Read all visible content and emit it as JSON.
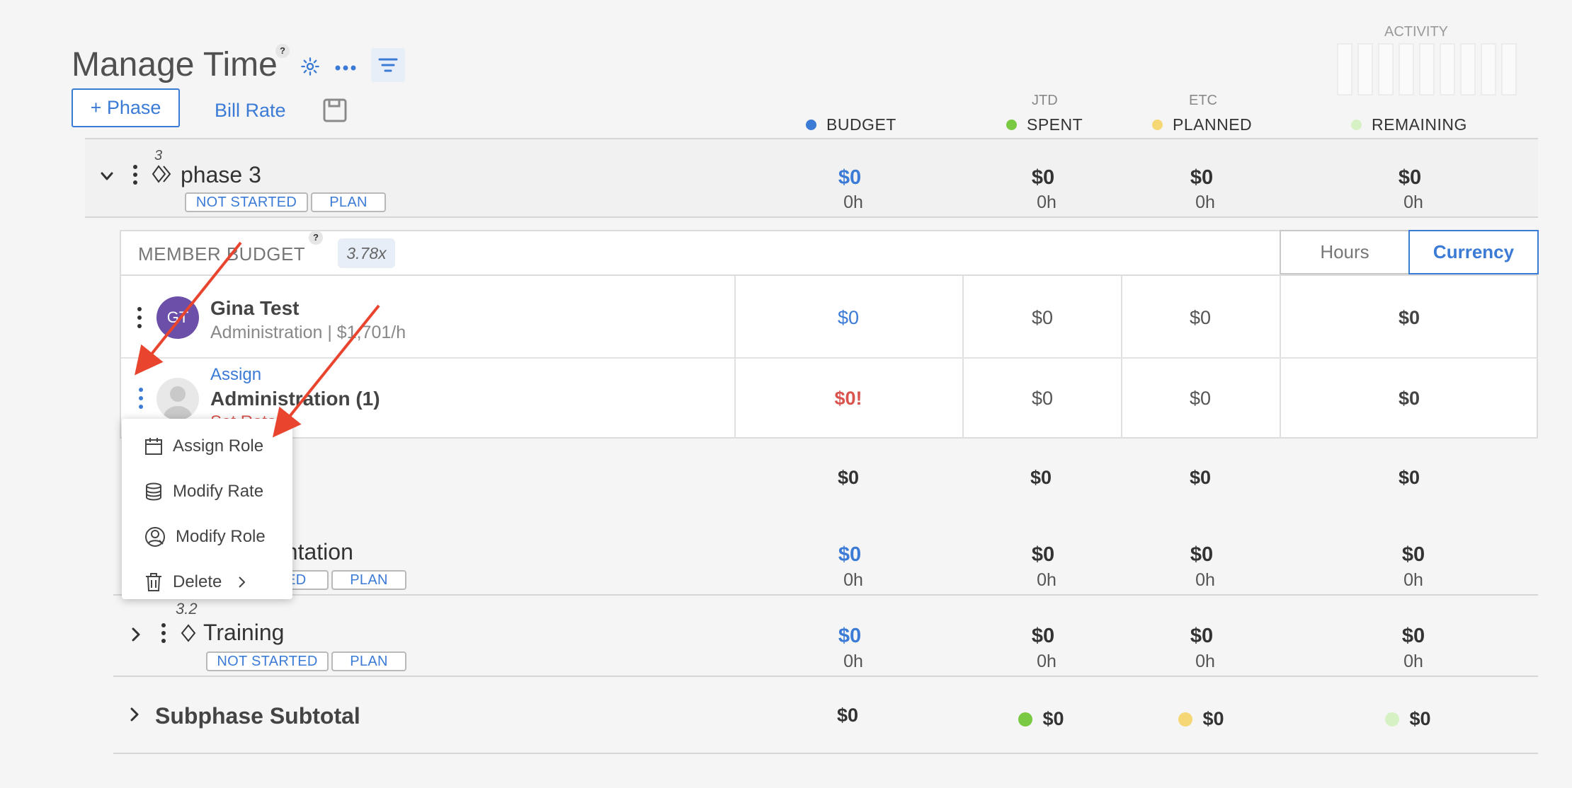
{
  "header": {
    "title": "Manage Time",
    "help": "?",
    "add_phase": "+ Phase",
    "bill_rate": "Bill Rate",
    "activity": "ACTIVITY"
  },
  "columns": {
    "budget": "BUDGET",
    "spent_sup": "JTD",
    "spent": "SPENT",
    "planned_sup": "ETC",
    "planned": "PLANNED",
    "remaining": "REMAINING"
  },
  "colors": {
    "budget": "#3b7bd6",
    "spent": "#7ac943",
    "planned": "#f6d775",
    "remaining": "#d6f2c4"
  },
  "phase": {
    "number": "3",
    "name": "phase 3",
    "status": "NOT STARTED",
    "plan": "PLAN",
    "budget": "$0",
    "budget_h": "0h",
    "spent": "$0",
    "spent_h": "0h",
    "planned": "$0",
    "planned_h": "0h",
    "remaining": "$0",
    "remaining_h": "0h"
  },
  "member_budget": {
    "label": "MEMBER BUDGET",
    "help": "?",
    "multiplier": "3.78x",
    "toggle_hours": "Hours",
    "toggle_currency": "Currency",
    "members": [
      {
        "initials": "GT",
        "name": "Gina Test",
        "sub": "Administration | $1,701/h",
        "budget": "$0",
        "spent": "$0",
        "planned": "$0",
        "remaining": "$0"
      },
      {
        "assign": "Assign",
        "name": "Administration (1)",
        "sub": "Set Rate",
        "budget": "$0!",
        "spent": "$0",
        "planned": "$0",
        "remaining": "$0"
      }
    ],
    "totals": {
      "budget": "$0",
      "spent": "$0",
      "planned": "$0",
      "remaining": "$0"
    }
  },
  "menu": {
    "assign_role": "Assign Role",
    "modify_rate": "Modify Rate",
    "modify_role": "Modify Role",
    "delete": "Delete"
  },
  "subphase1": {
    "name_partial": "entation",
    "status_partial": "TED",
    "plan": "PLAN",
    "budget": "$0",
    "budget_h": "0h",
    "spent": "$0",
    "spent_h": "0h",
    "planned": "$0",
    "planned_h": "0h",
    "remaining": "$0",
    "remaining_h": "0h"
  },
  "subphase2": {
    "number": "3.2",
    "name": "Training",
    "status": "NOT STARTED",
    "plan": "PLAN",
    "budget": "$0",
    "budget_h": "0h",
    "spent": "$0",
    "spent_h": "0h",
    "planned": "$0",
    "planned_h": "0h",
    "remaining": "$0",
    "remaining_h": "0h"
  },
  "subtotal": {
    "label": "Subphase Subtotal",
    "budget": "$0",
    "spent": "$0",
    "planned": "$0",
    "remaining": "$0"
  }
}
